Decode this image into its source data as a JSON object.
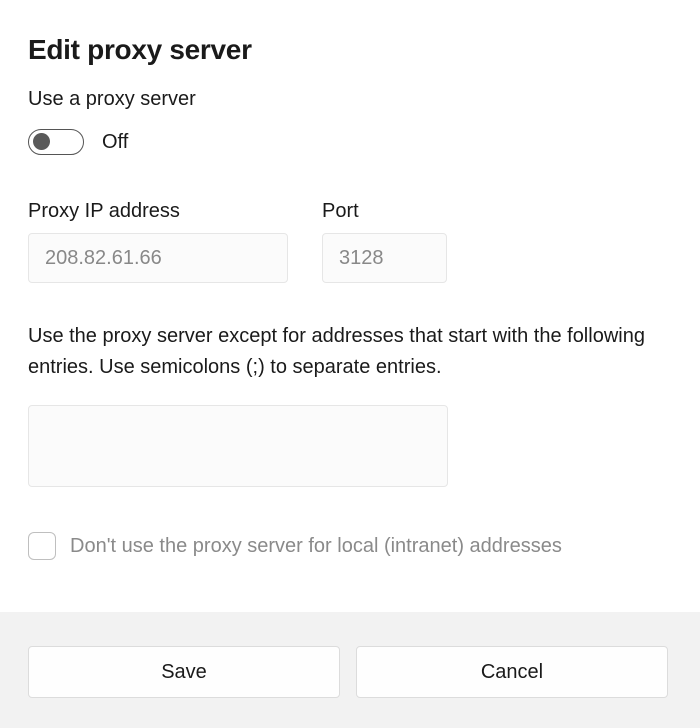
{
  "title": "Edit proxy server",
  "proxy_label": "Use a proxy server",
  "toggle": {
    "state_label": "Off"
  },
  "ip": {
    "label": "Proxy IP address",
    "value": "208.82.61.66"
  },
  "port": {
    "label": "Port",
    "value": "3128"
  },
  "exceptions": {
    "description": "Use the proxy server except for addresses that start with the following entries. Use semicolons (;) to separate entries.",
    "value": ""
  },
  "local_checkbox": {
    "label": "Don't use the proxy server for local (intranet) addresses"
  },
  "buttons": {
    "save": "Save",
    "cancel": "Cancel"
  }
}
